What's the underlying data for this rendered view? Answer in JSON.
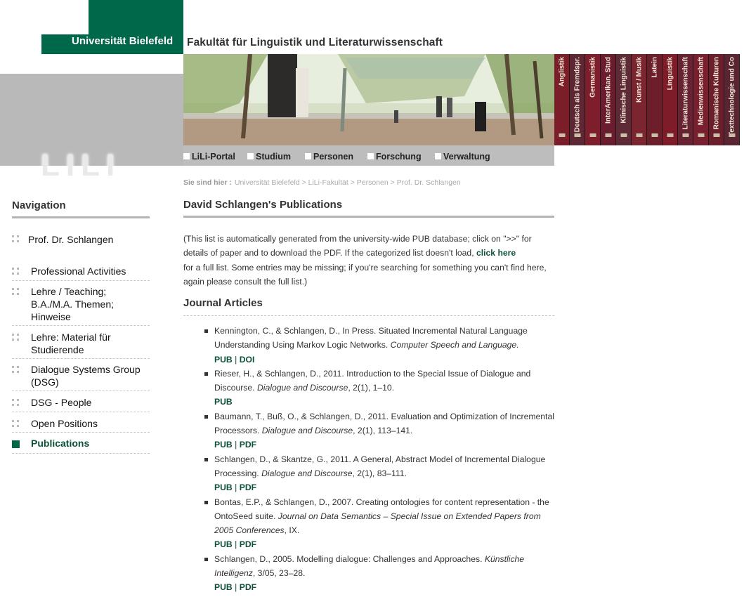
{
  "header": {
    "university": "Universität Bielefeld",
    "faculty": "Fakultät für Linguistik und Literaturwissenschaft",
    "lili": "LILI",
    "books": [
      "Anglistik",
      "Deutsch als Fremdspr.",
      "Germanistik",
      "InterAmerikan. Stud",
      "Klinische Linguistik",
      "Kunst / Musik",
      "Latein",
      "Linguistik",
      "Literaturwissenschaft",
      "Medienwissenschaft",
      "Romanische Kulturen",
      "Texttechnologie und Co"
    ],
    "tabs": [
      "LiLi-Portal",
      "Studium",
      "Personen",
      "Forschung",
      "Verwaltung"
    ]
  },
  "breadcrumb": {
    "label": "Sie sind hier :",
    "path": "Universität Bielefeld > LiLi-Fakultät > Personen > Prof. Dr. Schlangen"
  },
  "nav": {
    "title": "Navigation",
    "items": [
      "Prof. Dr. Schlangen",
      "Professional Activities",
      "Lehre / Teaching; B.A./M.A. Themen; Hinweise",
      "Lehre: Material für Studierende",
      "Dialogue Systems Group (DSG)",
      "DSG - People",
      "Open Positions",
      "Publications"
    ]
  },
  "content": {
    "title": "David Schlangen's Publications",
    "intro_a": "(This list is automatically generated from the university-wide PUB database; click on \">>\" for details of paper and to download the PDF. If the categorized list doesn't load,",
    "intro_link": "click here",
    "intro_b": "for a full list. Some entries may be missing; if you're searching for something you can't find here, again please consult the full list.)",
    "section": "Journal Articles",
    "pubs": [
      {
        "text": "Kennington, C., & Schlangen, D., In Press. Situated Incremental Natural Language Understanding Using Markov Logic Networks.",
        "venue": "Computer Speech and Language.",
        "rest": "",
        "l1": "PUB",
        "l2": "DOI"
      },
      {
        "text": "Rieser, H., & Schlangen, D., 2011. Introduction to the Special Issue of Dialogue and Discourse.",
        "venue": "Dialogue and Discourse",
        "rest": ", 2(1), 1–10.",
        "l1": "PUB",
        "l2": ""
      },
      {
        "text": "Baumann, T., Buß, O., & Schlangen, D., 2011. Evaluation and Optimization of Incremental Processors.",
        "venue": "Dialogue and Discourse",
        "rest": ", 2(1), 113–141.",
        "l1": "PUB",
        "l2": "PDF"
      },
      {
        "text": "Schlangen, D., & Skantze, G., 2011. A General, Abstract Model of Incremental Dialogue Processing.",
        "venue": "Dialogue and Discourse",
        "rest": ", 2(1), 83–111.",
        "l1": "PUB",
        "l2": "PDF"
      },
      {
        "text": "Bontas, E.P., & Schlangen, D., 2007. Creating ontologies for content representation - the OntoSeed suite.",
        "venue": "Journal on Data Semantics – Special Issue on Extended Papers from 2005 Conferences",
        "rest": ", IX.",
        "l1": "PUB",
        "l2": "PDF"
      },
      {
        "text": "Schlangen, D., 2005. Modelling dialogue: Challenges and Approaches.",
        "venue": "Künstliche Intelligenz",
        "rest": ", 3/05, 23–28.",
        "l1": "PUB",
        "l2": "PDF"
      }
    ]
  },
  "colors": {
    "brand_green": "#00684a",
    "link_green": "#0d5136",
    "band_grey": "#b9b9b9"
  }
}
